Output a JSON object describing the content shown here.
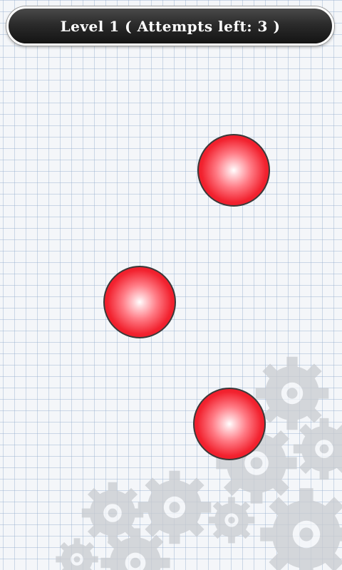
{
  "header": {
    "title": "Level 1 ( Attempts left: 3 )"
  },
  "balls": [
    {
      "name": "red-ball-1",
      "color": "#e8141f"
    },
    {
      "name": "red-ball-2",
      "color": "#e8141f"
    },
    {
      "name": "red-ball-3",
      "color": "#e8141f"
    }
  ],
  "background": {
    "pattern": "graph-paper-grid",
    "decoration": "gears-icon",
    "grid_color": "#a8bfd8"
  }
}
